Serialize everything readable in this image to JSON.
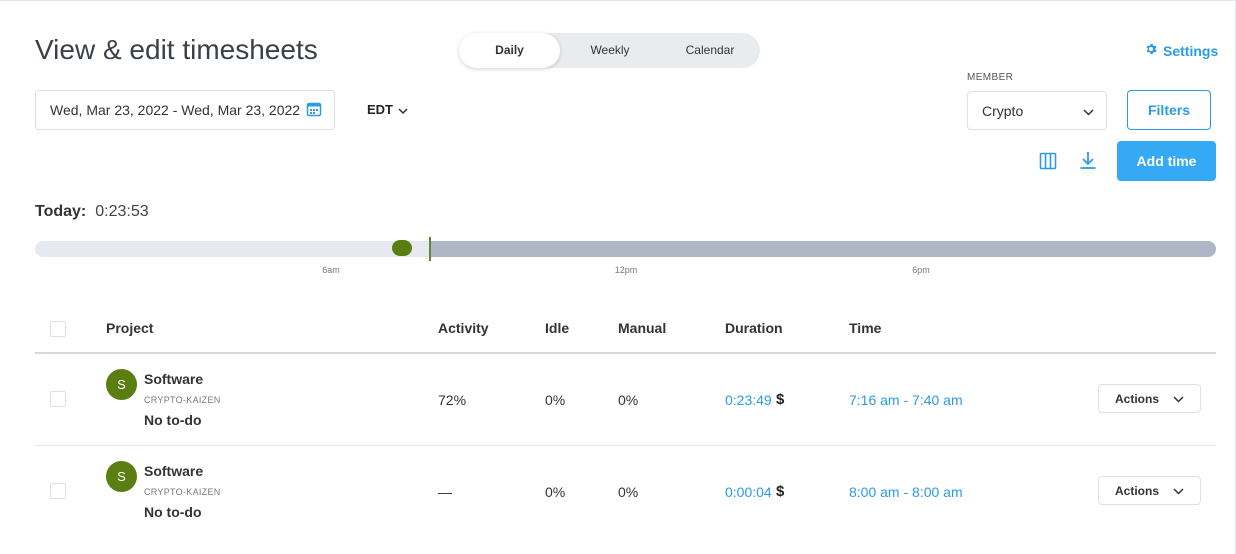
{
  "page": {
    "title": "View & edit timesheets"
  },
  "view_tabs": [
    {
      "label": "Daily",
      "active": true
    },
    {
      "label": "Weekly",
      "active": false
    },
    {
      "label": "Calendar",
      "active": false
    }
  ],
  "settings": {
    "label": "Settings",
    "icon": "gear-icon"
  },
  "date_range": {
    "value": "Wed, Mar 23, 2022 - Wed, Mar 23, 2022",
    "icon": "calendar-icon"
  },
  "timezone": {
    "value": "EDT"
  },
  "member": {
    "label": "MEMBER",
    "value": "Crypto"
  },
  "filters": {
    "label": "Filters"
  },
  "toolbar": {
    "columns_icon": "columns-icon",
    "download_icon": "download-icon",
    "add_time_label": "Add time"
  },
  "today": {
    "label": "Today:",
    "value": "0:23:53"
  },
  "timeline": {
    "ticks": [
      "6am",
      "12pm",
      "6pm"
    ],
    "colors": {
      "past": "#e6e9ef",
      "future": "#adb7c6",
      "entry": "#5b7e12"
    }
  },
  "table": {
    "columns": [
      "Project",
      "Activity",
      "Idle",
      "Manual",
      "Duration",
      "Time"
    ],
    "rows": [
      {
        "avatar": "S",
        "project": "Software",
        "org": "CRYPTO-KAIZEN",
        "todo": "No to-do",
        "activity": "72%",
        "idle": "0%",
        "manual": "0%",
        "duration": "0:23:49",
        "billable": "$",
        "time": "7:16 am - 7:40 am",
        "actions": "Actions"
      },
      {
        "avatar": "S",
        "project": "Software",
        "org": "CRYPTO-KAIZEN",
        "todo": "No to-do",
        "activity": "—",
        "idle": "0%",
        "manual": "0%",
        "duration": "0:00:04",
        "billable": "$",
        "time": "8:00 am - 8:00 am",
        "actions": "Actions"
      }
    ]
  },
  "colors": {
    "accent": "#2b9be5",
    "primary_button": "#35a9f3",
    "avatar": "#5b7e12"
  }
}
